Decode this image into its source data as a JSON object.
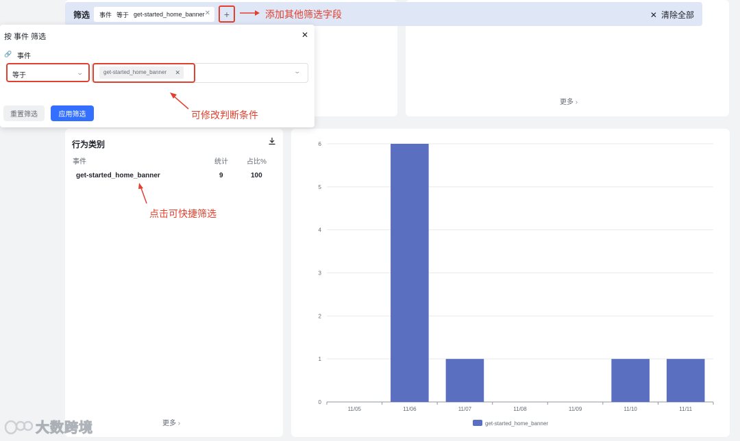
{
  "filter_bar": {
    "label": "筛选",
    "chip": {
      "field": "事件",
      "operator": "等于",
      "value": "get-started_home_banner"
    },
    "add_symbol": "+",
    "clear_all": "清除全部"
  },
  "annotations": {
    "add_field": "添加其他筛选字段",
    "modify_condition": "可修改判断条件",
    "quick_filter": "点击可快捷筛选"
  },
  "popup": {
    "title": "按 事件 筛选",
    "field_label": "事件",
    "operator": "等于",
    "value_tag": "get-started_home_banner",
    "reset_label": "重置筛选",
    "apply_label": "应用筛选"
  },
  "top_card": {
    "more_label": "更多"
  },
  "behavior_card": {
    "title": "行为类别",
    "headers": {
      "event": "事件",
      "count": "统计",
      "percent": "占比%"
    },
    "rows": [
      {
        "event": "get-started_home_banner",
        "count": "9",
        "percent": "100"
      }
    ],
    "more_label": "更多"
  },
  "chart_data": {
    "type": "bar",
    "categories": [
      "11/05",
      "11/06",
      "11/07",
      "11/08",
      "11/09",
      "11/10",
      "11/11"
    ],
    "series": [
      {
        "name": "get-started_home_banner",
        "values": [
          0,
          6,
          1,
          0,
          0,
          1,
          1
        ]
      }
    ],
    "ylim": [
      0,
      6
    ],
    "yticks": [
      "0",
      "1",
      "2",
      "3",
      "4",
      "5",
      "6"
    ],
    "legend_position": "bottom-center",
    "grid": true,
    "color": "#5b6fc1"
  },
  "watermark": {
    "text": "大数跨境"
  },
  "colors": {
    "accent": "#3370ff",
    "annotation": "#e0402e",
    "filter_bar_bg": "#dfe6f6"
  }
}
